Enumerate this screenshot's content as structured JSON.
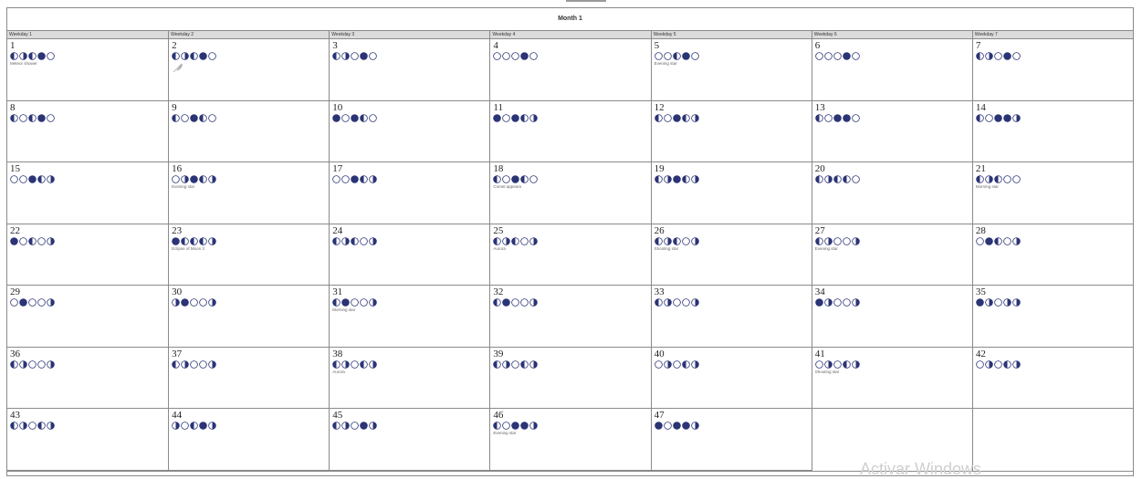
{
  "month": {
    "title": "Month 1"
  },
  "weekdays": [
    "Weekday 1",
    "Weekday 2",
    "Weekday 3",
    "Weekday 4",
    "Weekday 5",
    "Weekday 6",
    "Weekday 7"
  ],
  "colors": {
    "moon_fill": "#2b3475",
    "moon_light": "#ffffff",
    "grid_line": "#8a8a8a",
    "header_bg": "#dcdcdc"
  },
  "days": [
    {
      "num": "1",
      "phases": [
        "L",
        "R",
        "L",
        "F",
        "N"
      ],
      "event": "Meteor shower"
    },
    {
      "num": "2",
      "phases": [
        "L",
        "R",
        "L",
        "F",
        "N"
      ],
      "event": "",
      "icon": "feather-icon"
    },
    {
      "num": "3",
      "phases": [
        "L",
        "R",
        "N",
        "F",
        "N"
      ],
      "event": ""
    },
    {
      "num": "4",
      "phases": [
        "N",
        "N",
        "N",
        "F",
        "N"
      ],
      "event": ""
    },
    {
      "num": "5",
      "phases": [
        "N",
        "N",
        "L",
        "F",
        "N"
      ],
      "event": "Evening star"
    },
    {
      "num": "6",
      "phases": [
        "N",
        "N",
        "N",
        "F",
        "N"
      ],
      "event": ""
    },
    {
      "num": "7",
      "phases": [
        "L",
        "R",
        "N",
        "F",
        "N"
      ],
      "event": ""
    },
    {
      "num": "8",
      "phases": [
        "L",
        "N",
        "L",
        "F",
        "N"
      ],
      "event": ""
    },
    {
      "num": "9",
      "phases": [
        "L",
        "N",
        "F",
        "L",
        "N"
      ],
      "event": ""
    },
    {
      "num": "10",
      "phases": [
        "F",
        "N",
        "F",
        "L",
        "N"
      ],
      "event": ""
    },
    {
      "num": "11",
      "phases": [
        "F",
        "N",
        "F",
        "L",
        "R"
      ],
      "event": ""
    },
    {
      "num": "12",
      "phases": [
        "L",
        "N",
        "F",
        "L",
        "R"
      ],
      "event": ""
    },
    {
      "num": "13",
      "phases": [
        "L",
        "N",
        "F",
        "F",
        "N"
      ],
      "event": ""
    },
    {
      "num": "14",
      "phases": [
        "L",
        "N",
        "F",
        "F",
        "R"
      ],
      "event": ""
    },
    {
      "num": "15",
      "phases": [
        "N",
        "N",
        "F",
        "L",
        "R"
      ],
      "event": ""
    },
    {
      "num": "16",
      "phases": [
        "N",
        "R",
        "F",
        "L",
        "R"
      ],
      "event": "Evening star"
    },
    {
      "num": "17",
      "phases": [
        "N",
        "N",
        "F",
        "L",
        "R"
      ],
      "event": ""
    },
    {
      "num": "18",
      "phases": [
        "L",
        "N",
        "F",
        "L",
        "N"
      ],
      "event": "Comet appears"
    },
    {
      "num": "19",
      "phases": [
        "L",
        "R",
        "F",
        "L",
        "R"
      ],
      "event": ""
    },
    {
      "num": "20",
      "phases": [
        "L",
        "R",
        "L",
        "L",
        "N"
      ],
      "event": ""
    },
    {
      "num": "21",
      "phases": [
        "L",
        "R",
        "L",
        "N",
        "N"
      ],
      "event": "Morning star"
    },
    {
      "num": "22",
      "phases": [
        "F",
        "N",
        "L",
        "N",
        "R"
      ],
      "event": ""
    },
    {
      "num": "23",
      "phases": [
        "F",
        "L",
        "L",
        "L",
        "R"
      ],
      "event": "Eclipse of Moon 3"
    },
    {
      "num": "24",
      "phases": [
        "L",
        "R",
        "L",
        "N",
        "R"
      ],
      "event": ""
    },
    {
      "num": "25",
      "phases": [
        "L",
        "R",
        "L",
        "N",
        "R"
      ],
      "event": "Aurora"
    },
    {
      "num": "26",
      "phases": [
        "L",
        "R",
        "L",
        "N",
        "R"
      ],
      "event": "Shooting star"
    },
    {
      "num": "27",
      "phases": [
        "L",
        "R",
        "N",
        "N",
        "R"
      ],
      "event": "Evening star"
    },
    {
      "num": "28",
      "phases": [
        "N",
        "F",
        "L",
        "N",
        "R"
      ],
      "event": ""
    },
    {
      "num": "29",
      "phases": [
        "N",
        "F",
        "N",
        "N",
        "R"
      ],
      "event": ""
    },
    {
      "num": "30",
      "phases": [
        "R",
        "F",
        "N",
        "N",
        "R"
      ],
      "event": ""
    },
    {
      "num": "31",
      "phases": [
        "L",
        "F",
        "N",
        "N",
        "R"
      ],
      "event": "Morning star"
    },
    {
      "num": "32",
      "phases": [
        "L",
        "F",
        "N",
        "N",
        "R"
      ],
      "event": ""
    },
    {
      "num": "33",
      "phases": [
        "L",
        "R",
        "N",
        "N",
        "R"
      ],
      "event": ""
    },
    {
      "num": "34",
      "phases": [
        "F",
        "R",
        "N",
        "N",
        "R"
      ],
      "event": ""
    },
    {
      "num": "35",
      "phases": [
        "F",
        "R",
        "N",
        "R",
        "R"
      ],
      "event": ""
    },
    {
      "num": "36",
      "phases": [
        "L",
        "R",
        "N",
        "N",
        "R"
      ],
      "event": ""
    },
    {
      "num": "37",
      "phases": [
        "L",
        "R",
        "N",
        "N",
        "R"
      ],
      "event": ""
    },
    {
      "num": "38",
      "phases": [
        "L",
        "R",
        "N",
        "L",
        "R"
      ],
      "event": "Aurora"
    },
    {
      "num": "39",
      "phases": [
        "L",
        "R",
        "N",
        "L",
        "R"
      ],
      "event": ""
    },
    {
      "num": "40",
      "phases": [
        "N",
        "R",
        "N",
        "L",
        "R"
      ],
      "event": ""
    },
    {
      "num": "41",
      "phases": [
        "N",
        "R",
        "N",
        "L",
        "R"
      ],
      "event": "Shooting star"
    },
    {
      "num": "42",
      "phases": [
        "N",
        "R",
        "N",
        "L",
        "R"
      ],
      "event": ""
    },
    {
      "num": "43",
      "phases": [
        "L",
        "R",
        "N",
        "L",
        "R"
      ],
      "event": ""
    },
    {
      "num": "44",
      "phases": [
        "R",
        "N",
        "L",
        "F",
        "R"
      ],
      "event": ""
    },
    {
      "num": "45",
      "phases": [
        "L",
        "R",
        "N",
        "F",
        "R"
      ],
      "event": ""
    },
    {
      "num": "46",
      "phases": [
        "L",
        "N",
        "F",
        "F",
        "R"
      ],
      "event": "Evening star"
    },
    {
      "num": "47",
      "phases": [
        "F",
        "N",
        "F",
        "F",
        "R"
      ],
      "event": ""
    }
  ],
  "watermark": "Activar Windows"
}
